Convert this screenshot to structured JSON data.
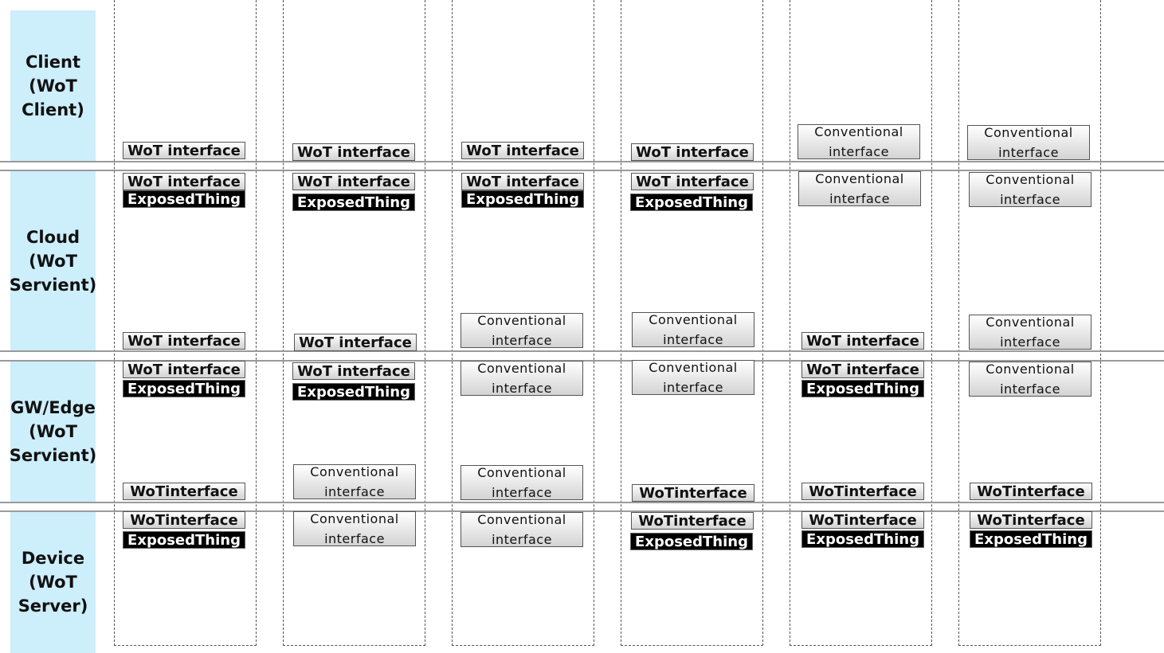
{
  "tiers": {
    "client": "Client\n(WoT\nClient)",
    "cloud": "Cloud\n(WoT\nServient)",
    "gw": "GW/Edge\n(WoT\nServient)",
    "device": "Device\n(WoT\nServer)"
  },
  "labels": {
    "wot_interface": "WoT interface",
    "wot_interface_nospace": "WoTinterface",
    "exposed_thing": "ExposedThing",
    "conventional_interface": "Conventional\ninterface"
  }
}
